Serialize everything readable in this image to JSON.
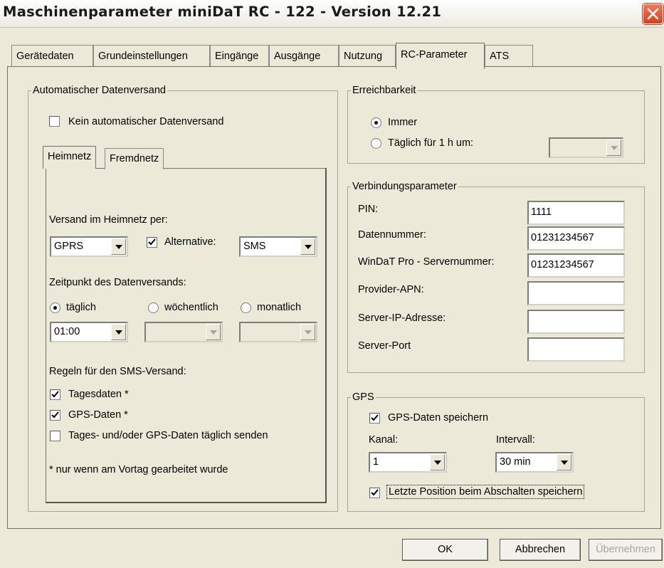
{
  "window": {
    "title": "Maschinenparameter miniDaT RC - 122 - Version 12.21"
  },
  "tabs": [
    {
      "label": "Gerätedaten"
    },
    {
      "label": "Grundeinstellungen"
    },
    {
      "label": "Eingänge"
    },
    {
      "label": "Ausgänge"
    },
    {
      "label": "Nutzung"
    },
    {
      "label": "RC-Parameter",
      "selected": true
    },
    {
      "label": "ATS"
    }
  ],
  "datenversand": {
    "title": "Automatischer Datenversand",
    "kein_label": "Kein automatischer Datenversand",
    "kein_checked": false,
    "subtabs": [
      {
        "label": "Heimnetz",
        "selected": true
      },
      {
        "label": "Fremdnetz"
      }
    ],
    "versand_label": "Versand im Heimnetz per:",
    "versand_value": "GPRS",
    "alternative_label": "Alternative:",
    "alternative_checked": true,
    "alternative_value": "SMS",
    "zeitpunkt_label": "Zeitpunkt des Datenversands:",
    "radio_taeglich": "täglich",
    "radio_woechentlich": "wöchentlich",
    "radio_monatlich": "monatlich",
    "selected_interval": "täglich",
    "time_value": "01:00",
    "woechentlich_value": "",
    "monatlich_value": "",
    "regeln_label": "Regeln für den SMS-Versand:",
    "tagesdaten_label": "Tagesdaten *",
    "tagesdaten_checked": true,
    "gpsdaten_label": "GPS-Daten *",
    "gpsdaten_checked": true,
    "taeglich_senden_label": "Tages- und/oder GPS-Daten täglich senden",
    "taeglich_senden_checked": false,
    "footnote": "* nur wenn am Vortag gearbeitet wurde"
  },
  "erreichbarkeit": {
    "title": "Erreichbarkeit",
    "immer_label": "Immer",
    "taeglich_label": "Täglich für 1 h um:",
    "selected": "Immer",
    "time_value": ""
  },
  "verbindung": {
    "title": "Verbindungsparameter",
    "pin_label": "PIN:",
    "pin_value": "1111",
    "datennummer_label": "Datennummer:",
    "datennummer_value": "01231234567",
    "server_label": "WinDaT Pro - Servernummer:",
    "server_value": "01231234567",
    "apn_label": "Provider-APN:",
    "apn_value": "",
    "ip_label": "Server-IP-Adresse:",
    "ip_value": "",
    "port_label": "Server-Port",
    "port_value": ""
  },
  "gps": {
    "title": "GPS",
    "speichern_label": "GPS-Daten speichern",
    "speichern_checked": true,
    "kanal_label": "Kanal:",
    "kanal_value": "1",
    "intervall_label": "Intervall:",
    "intervall_value": "30 min",
    "letzte_label": "Letzte Position beim Abschalten speichern",
    "letzte_checked": true
  },
  "buttons": {
    "ok": "OK",
    "abbrechen": "Abbrechen",
    "uebernehmen": "Übernehmen"
  },
  "colors": {
    "face": "#ece9d8",
    "close": "#d3401d",
    "disabled_text": "#a8a59a"
  }
}
